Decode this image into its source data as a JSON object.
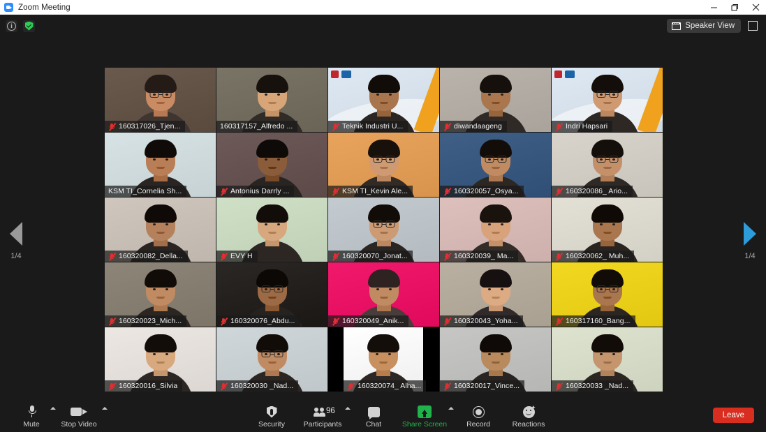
{
  "window": {
    "title": "Zoom Meeting",
    "app_icon": "zoom-logo-icon",
    "minimize_label": "Minimize",
    "maximize_label": "Restore",
    "close_label": "Close"
  },
  "topbar": {
    "info_icon": "info-icon",
    "encryption_icon": "shield-check-icon",
    "view_mode": "Speaker View",
    "view_mode_icon": "speaker-view-icon",
    "fullscreen_icon": "enter-fullscreen-icon"
  },
  "pager": {
    "prev_icon": "chevron-left-icon",
    "prev_label": "1/4",
    "prev_color": "#9a9a9a",
    "next_icon": "chevron-right-icon",
    "next_label": "1/4",
    "next_color": "#2d9cdb"
  },
  "gallery": {
    "active_border_color": "#cdf05a",
    "muted_icon_color": "#e02f2f",
    "participants": [
      {
        "name": "160317026_Tjen...",
        "muted": true,
        "active": false,
        "bg": "#6a5a4e",
        "skin": "#c98b63",
        "hair": "#241a16",
        "glasses": true,
        "wide": true
      },
      {
        "name": "160317157_Alfredo ...",
        "muted": false,
        "active": true,
        "bg": "#7a7466",
        "skin": "#d8a578",
        "hair": "#17110d",
        "glasses": false,
        "wide": true
      },
      {
        "name": "Teknik Industri U...",
        "muted": true,
        "active": false,
        "bg": "#dfe9f4",
        "skin": "#a8754c",
        "hair": "#120c08",
        "glasses": false,
        "logo": true
      },
      {
        "name": "diwandaageng",
        "muted": true,
        "active": false,
        "bg": "#b9b3ab",
        "skin": "#a9764e",
        "hair": "#15100c",
        "glasses": false
      },
      {
        "name": "Indri Hapsari",
        "muted": true,
        "active": false,
        "bg": "#dfe9f4",
        "skin": "#cf9a72",
        "hair": "#140e0a",
        "glasses": true,
        "logo": true
      },
      {
        "name": "KSM TI_Cornelia Sh...",
        "muted": false,
        "active": false,
        "bg": "#d6e2e4",
        "skin": "#b97e55",
        "hair": "#100b08",
        "glasses": false
      },
      {
        "name": "Antonius Darrly ...",
        "muted": true,
        "active": false,
        "bg": "#6d5a58",
        "skin": "#8a5c3a",
        "hair": "#0e0a07",
        "glasses": false
      },
      {
        "name": "KSM TI_Kevin Ale...",
        "muted": true,
        "active": false,
        "bg": "#e8a35c",
        "skin": "#cf9a72",
        "hair": "#17100b",
        "glasses": true
      },
      {
        "name": "160320057_Osya...",
        "muted": true,
        "active": false,
        "bg": "#3f5f86",
        "skin": "#c08b62",
        "hair": "#130d09",
        "glasses": true
      },
      {
        "name": "160320086_ Ario...",
        "muted": true,
        "active": false,
        "bg": "#d8d4cc",
        "skin": "#c4906a",
        "hair": "#150f0b",
        "glasses": true
      },
      {
        "name": "160320082_Della...",
        "muted": true,
        "active": false,
        "bg": "#cfc6bd",
        "skin": "#b4815c",
        "hair": "#0f0a07",
        "glasses": false
      },
      {
        "name": "EVY H",
        "muted": true,
        "active": false,
        "bg": "#cfe0c6",
        "skin": "#d7a87e",
        "hair": "#120d09",
        "glasses": false
      },
      {
        "name": "160320070_Jonat...",
        "muted": true,
        "active": false,
        "bg": "#c3cbd0",
        "skin": "#cc9a73",
        "hair": "#120c08",
        "glasses": true
      },
      {
        "name": "160320039_ Ma...",
        "muted": true,
        "active": false,
        "bg": "#ddbfbc",
        "skin": "#d8a27a",
        "hair": "#1a120d",
        "glasses": false
      },
      {
        "name": "160320062_ Muh...",
        "muted": true,
        "active": false,
        "bg": "#e3e0d6",
        "skin": "#a9764e",
        "hair": "#100a07",
        "glasses": false
      },
      {
        "name": "160320023_Mich...",
        "muted": true,
        "active": false,
        "bg": "#8d8578",
        "skin": "#c08b62",
        "hair": "#120c08",
        "glasses": false
      },
      {
        "name": "160320076_Abdu...",
        "muted": true,
        "active": false,
        "bg": "#2b2725",
        "skin": "#9c6b45",
        "hair": "#0b0806",
        "glasses": true
      },
      {
        "name": "160320049_Anik...",
        "muted": true,
        "active": false,
        "bg": "#f0196b",
        "skin": "#c08b62",
        "hair": "#2e2320",
        "glasses": false
      },
      {
        "name": "160320043_Yoha...",
        "muted": true,
        "active": false,
        "bg": "#b9b0a2",
        "skin": "#dcab83",
        "hair": "#171010",
        "glasses": false
      },
      {
        "name": "160317160_Bang...",
        "muted": true,
        "active": false,
        "bg": "#f2d821",
        "skin": "#a9764e",
        "hair": "#120c08",
        "glasses": true
      },
      {
        "name": "160320016_Silvia",
        "muted": true,
        "active": false,
        "bg": "#ece7e3",
        "skin": "#d8a87e",
        "hair": "#130d09",
        "glasses": false
      },
      {
        "name": "160320030 _Nad...",
        "muted": true,
        "active": false,
        "bg": "#cfd7da",
        "skin": "#c08b62",
        "hair": "#120c08",
        "glasses": true
      },
      {
        "name": "160320074_ Alha...",
        "muted": true,
        "active": false,
        "bg": "#ffffff",
        "skin": "#c9905f",
        "hair": "#140e0a",
        "glasses": false,
        "narrow": true
      },
      {
        "name": "160320017_Vince...",
        "muted": true,
        "active": false,
        "bg": "#c6c6c4",
        "skin": "#b98a5e",
        "hair": "#0f0a07",
        "glasses": false
      },
      {
        "name": "160320033 _Nad...",
        "muted": true,
        "active": false,
        "bg": "#dde3cf",
        "skin": "#c5966e",
        "hair": "#120c08",
        "glasses": false
      }
    ]
  },
  "toolbar": {
    "mute": {
      "label": "Mute",
      "icon": "microphone-icon"
    },
    "stop_video": {
      "label": "Stop Video",
      "icon": "camera-icon"
    },
    "security": {
      "label": "Security",
      "icon": "shield-icon"
    },
    "participants": {
      "label": "Participants",
      "icon": "people-icon",
      "count": "96"
    },
    "chat": {
      "label": "Chat",
      "icon": "chat-bubble-icon"
    },
    "share_screen": {
      "label": "Share Screen",
      "icon": "share-screen-icon",
      "color": "#24b14b"
    },
    "record": {
      "label": "Record",
      "icon": "record-icon"
    },
    "reactions": {
      "label": "Reactions",
      "icon": "smiley-reactions-icon"
    },
    "leave": {
      "label": "Leave",
      "color": "#d92d20"
    }
  }
}
